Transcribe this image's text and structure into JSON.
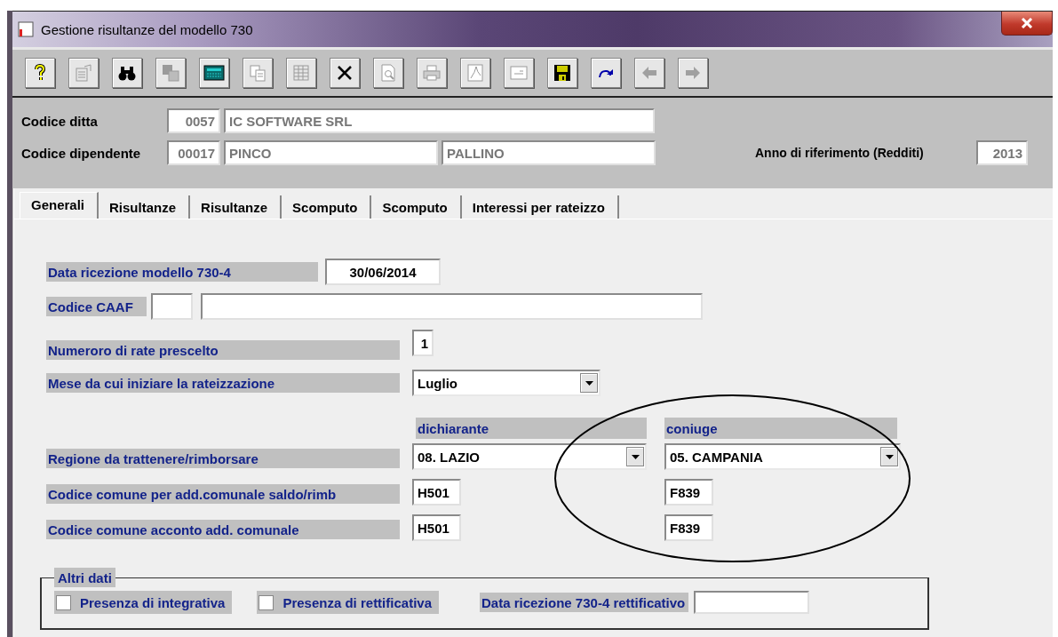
{
  "window": {
    "title": "Gestione risultanze del modello 730"
  },
  "toolbar": [
    {
      "kind": "help",
      "disabled": false
    },
    {
      "kind": "properties",
      "disabled": true
    },
    {
      "kind": "find",
      "disabled": false
    },
    {
      "kind": "squares",
      "disabled": true
    },
    {
      "kind": "calculator",
      "disabled": false
    },
    {
      "kind": "copy",
      "disabled": true
    },
    {
      "kind": "grid",
      "disabled": true
    },
    {
      "kind": "delete",
      "disabled": false
    },
    {
      "kind": "preview",
      "disabled": true
    },
    {
      "kind": "print",
      "disabled": true
    },
    {
      "kind": "pdf",
      "disabled": true
    },
    {
      "kind": "form",
      "disabled": true
    },
    {
      "kind": "save",
      "disabled": false
    },
    {
      "kind": "redo",
      "disabled": false
    },
    {
      "kind": "back",
      "disabled": true
    },
    {
      "kind": "forward",
      "disabled": true
    }
  ],
  "header": {
    "company": {
      "label": "Codice ditta",
      "code": "0057",
      "name": "IC SOFTWARE SRL"
    },
    "employee": {
      "label": "Codice dipendente",
      "code": "00017",
      "surname": "PINCO",
      "name": "PALLINO"
    },
    "year": {
      "label": "Anno di riferimento (Redditi)",
      "value": "2013"
    }
  },
  "tabs": [
    {
      "label": "Generali",
      "selected": true
    },
    {
      "label": "Risultanze",
      "selected": false
    },
    {
      "label": "Risultanze",
      "selected": false
    },
    {
      "label": "Scomputo",
      "selected": false
    },
    {
      "label": "Scomputo",
      "selected": false
    },
    {
      "label": "Interessi per rateizzo",
      "selected": false
    }
  ],
  "form": {
    "receipt_date": {
      "label": "Data ricezione modello 730-4",
      "value": "30/06/2014"
    },
    "caaf": {
      "label": "Codice CAAF"
    },
    "installments": {
      "label": "Numeroro di  rate prescelto",
      "value": "1"
    },
    "start_month": {
      "label": "Mese da cui iniziare la rateizzazione",
      "value": "Luglio"
    },
    "columns": [
      "dichiarante",
      "coniuge"
    ],
    "rows": [
      {
        "label": "Regione da trattenere/rimborsare",
        "kind": "select",
        "values": [
          "08. LAZIO",
          "05. CAMPANIA"
        ]
      },
      {
        "label": "Codice comune per add.comunale saldo/rimb",
        "kind": "text",
        "values": [
          "H501",
          "F839"
        ]
      },
      {
        "label": "Codice comune acconto add. comunale",
        "kind": "text",
        "values": [
          "H501",
          "F839"
        ]
      }
    ]
  },
  "other": {
    "legend": "Altri dati",
    "checks": [
      {
        "label": "Presenza di integrativa",
        "checked": false
      },
      {
        "label": "Presenza di rettificativa",
        "checked": false
      }
    ],
    "date_label": "Data ricezione 730-4 rettificativo"
  }
}
